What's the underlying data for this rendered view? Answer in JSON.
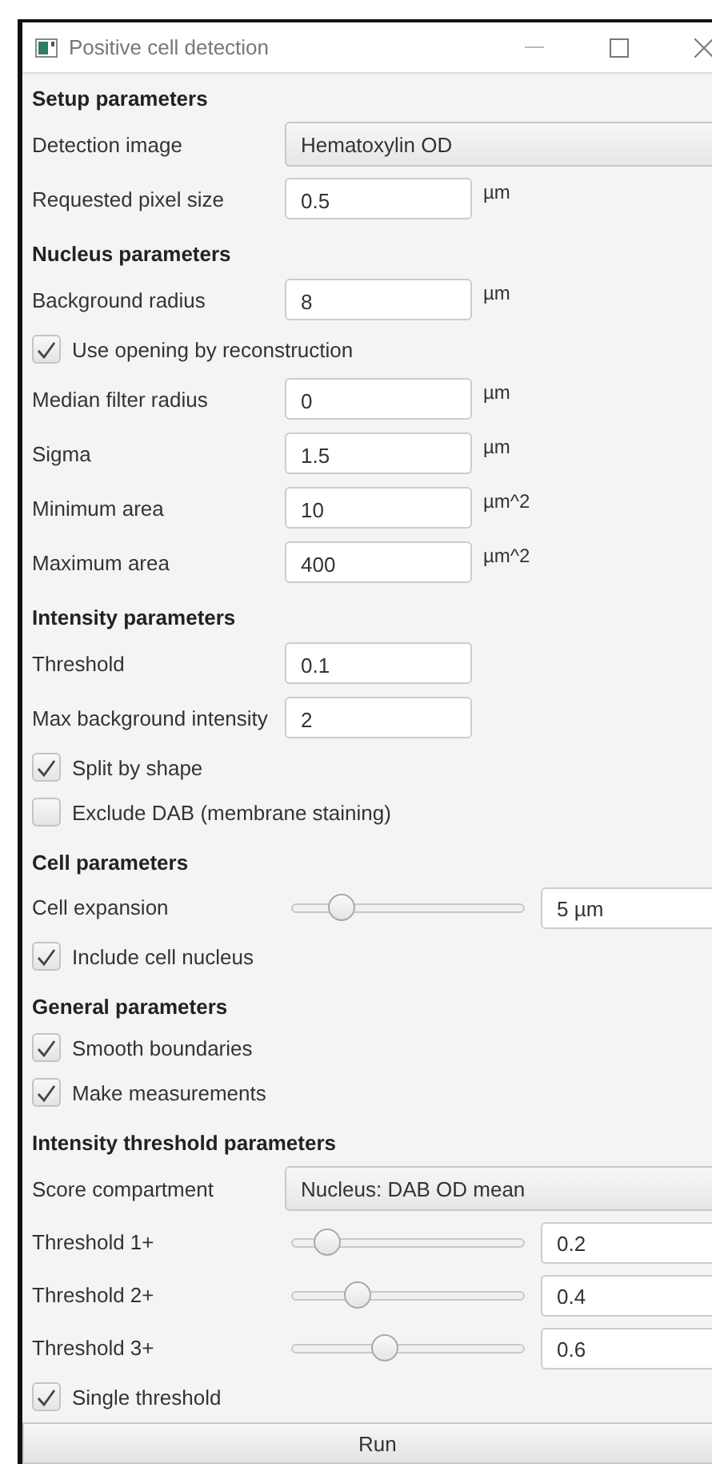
{
  "window": {
    "title": "Positive cell detection"
  },
  "sections": [
    {
      "title": "Setup parameters",
      "rows": [
        {
          "kind": "select",
          "label": "Detection image",
          "value": "Hematoxylin OD"
        },
        {
          "kind": "field",
          "label": "Requested pixel size",
          "value": "0.5",
          "unit": "µm"
        }
      ]
    },
    {
      "title": "Nucleus parameters",
      "rows": [
        {
          "kind": "field",
          "label": "Background radius",
          "value": "8",
          "unit": "µm"
        },
        {
          "kind": "checkbox",
          "label": "Use opening by reconstruction",
          "checked": true
        },
        {
          "kind": "field",
          "label": "Median filter radius",
          "value": "0",
          "unit": "µm"
        },
        {
          "kind": "field",
          "label": "Sigma",
          "value": "1.5",
          "unit": "µm"
        },
        {
          "kind": "field",
          "label": "Minimum area",
          "value": "10",
          "unit": "µm^2"
        },
        {
          "kind": "field",
          "label": "Maximum area",
          "value": "400",
          "unit": "µm^2"
        }
      ]
    },
    {
      "title": "Intensity parameters",
      "rows": [
        {
          "kind": "field",
          "label": "Threshold",
          "value": "0.1"
        },
        {
          "kind": "field",
          "label": "Max background intensity",
          "value": "2"
        },
        {
          "kind": "checkbox",
          "label": "Split by shape",
          "checked": true
        },
        {
          "kind": "checkbox",
          "label": "Exclude DAB (membrane staining)",
          "checked": false
        }
      ]
    },
    {
      "title": "Cell parameters",
      "rows": [
        {
          "kind": "slider",
          "label": "Cell expansion",
          "value": "5 µm",
          "level": 0.21
        },
        {
          "kind": "checkbox",
          "label": "Include cell nucleus",
          "checked": true
        }
      ]
    },
    {
      "title": "General parameters",
      "rows": [
        {
          "kind": "checkbox",
          "label": "Smooth boundaries",
          "checked": true
        },
        {
          "kind": "checkbox",
          "label": "Make measurements",
          "checked": true
        }
      ]
    },
    {
      "title": "Intensity threshold parameters",
      "rows": [
        {
          "kind": "select",
          "label": "Score compartment",
          "value": "Nucleus: DAB OD mean"
        },
        {
          "kind": "slider",
          "label": "Threshold 1+",
          "value": "0.2",
          "level": 0.15
        },
        {
          "kind": "slider",
          "label": "Threshold 2+",
          "value": "0.4",
          "level": 0.28
        },
        {
          "kind": "slider",
          "label": "Threshold 3+",
          "value": "0.6",
          "level": 0.4
        },
        {
          "kind": "checkbox",
          "label": "Single threshold",
          "checked": true
        }
      ]
    }
  ],
  "run_button": {
    "label": "Run"
  }
}
